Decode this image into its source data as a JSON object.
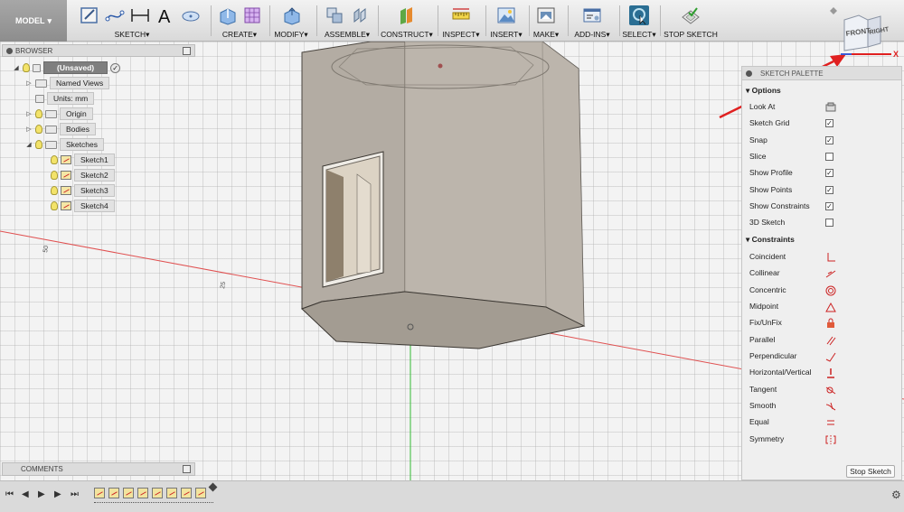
{
  "toolbar": {
    "model_label": "MODEL",
    "groups": {
      "sketch": "SKETCH",
      "create": "CREATE",
      "modify": "MODIFY",
      "assemble": "ASSEMBLE",
      "construct": "CONSTRUCT",
      "inspect": "INSPECT",
      "insert": "INSERT",
      "make": "MAKE",
      "add_ins": "ADD-INS",
      "select": "SELECT",
      "stop_sketch": "STOP SKETCH"
    }
  },
  "browser": {
    "title": "BROWSER",
    "root": "(Unsaved)",
    "items": {
      "named_views": "Named Views",
      "units": "Units: mm",
      "origin": "Origin",
      "bodies": "Bodies",
      "sketches": "Sketches",
      "sketch1": "Sketch1",
      "sketch2": "Sketch2",
      "sketch3": "Sketch3",
      "sketch4": "Sketch4"
    }
  },
  "comments": {
    "title": "COMMENTS"
  },
  "viewport": {
    "dim_50": "50",
    "dim_25": "25"
  },
  "viewcube": {
    "front": "FRONT",
    "right": "RIGHT",
    "x_axis": "X"
  },
  "palette": {
    "title": "SKETCH PALETTE",
    "options_header": "Options",
    "options": {
      "look_at": "Look At",
      "sketch_grid": "Sketch Grid",
      "snap": "Snap",
      "slice": "Slice",
      "show_profile": "Show Profile",
      "show_points": "Show Points",
      "show_constraints": "Show Constraints",
      "sketch_3d": "3D Sketch"
    },
    "options_checked": {
      "sketch_grid": true,
      "snap": true,
      "slice": false,
      "show_profile": true,
      "show_points": true,
      "show_constraints": true,
      "sketch_3d": false
    },
    "constraints_header": "Constraints",
    "constraints": {
      "coincident": "Coincident",
      "collinear": "Collinear",
      "concentric": "Concentric",
      "midpoint": "Midpoint",
      "fix_unfix": "Fix/UnFix",
      "parallel": "Parallel",
      "perpendicular": "Perpendicular",
      "horizontal_vertical": "Horizontal/Vertical",
      "tangent": "Tangent",
      "smooth": "Smooth",
      "equal": "Equal",
      "symmetry": "Symmetry"
    },
    "stop_sketch": "Stop Sketch"
  },
  "colors": {
    "accent_red": "#e02020",
    "body_fill": "#b3aca3",
    "x_axis": "#e05050",
    "y_axis": "#33bb33"
  }
}
